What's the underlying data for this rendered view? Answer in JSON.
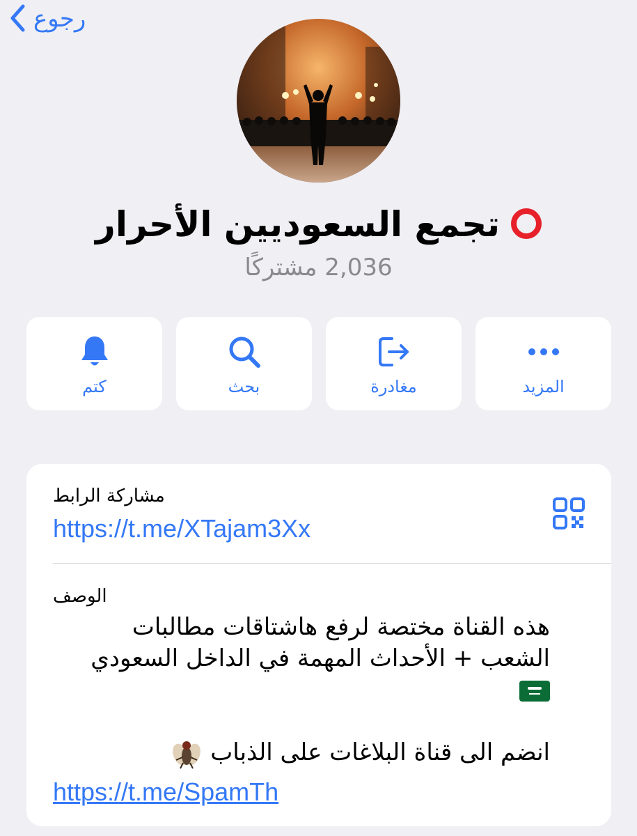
{
  "header": {
    "back_label": "رجوع"
  },
  "channel": {
    "title": "تجمع السعوديين الأحرار",
    "subscribers": "2,036 مشتركًا"
  },
  "actions": [
    {
      "label": "المزيد",
      "icon": "more-icon"
    },
    {
      "label": "مغادرة",
      "icon": "leave-icon"
    },
    {
      "label": "بحث",
      "icon": "search-icon"
    },
    {
      "label": "كتم",
      "icon": "bell-icon"
    }
  ],
  "info": {
    "link_label": "مشاركة الرابط",
    "link_url": "https://t.me/XTajam3Xx",
    "description_label": "الوصف",
    "description_lines": [
      "هذه القناة مختصة لرفع هاشتاقات مطالبات",
      "الشعب + الأحداث المهمة في الداخل السعودي",
      "انضم الى قناة البلاغات على الذباب"
    ],
    "description_link": "https://t.me/SpamTh"
  },
  "colors": {
    "accent": "#3478f6",
    "background": "#efeff4",
    "card": "#ffffff",
    "secondary_text": "#8a8a8e",
    "title_icon": "#e7202a"
  }
}
